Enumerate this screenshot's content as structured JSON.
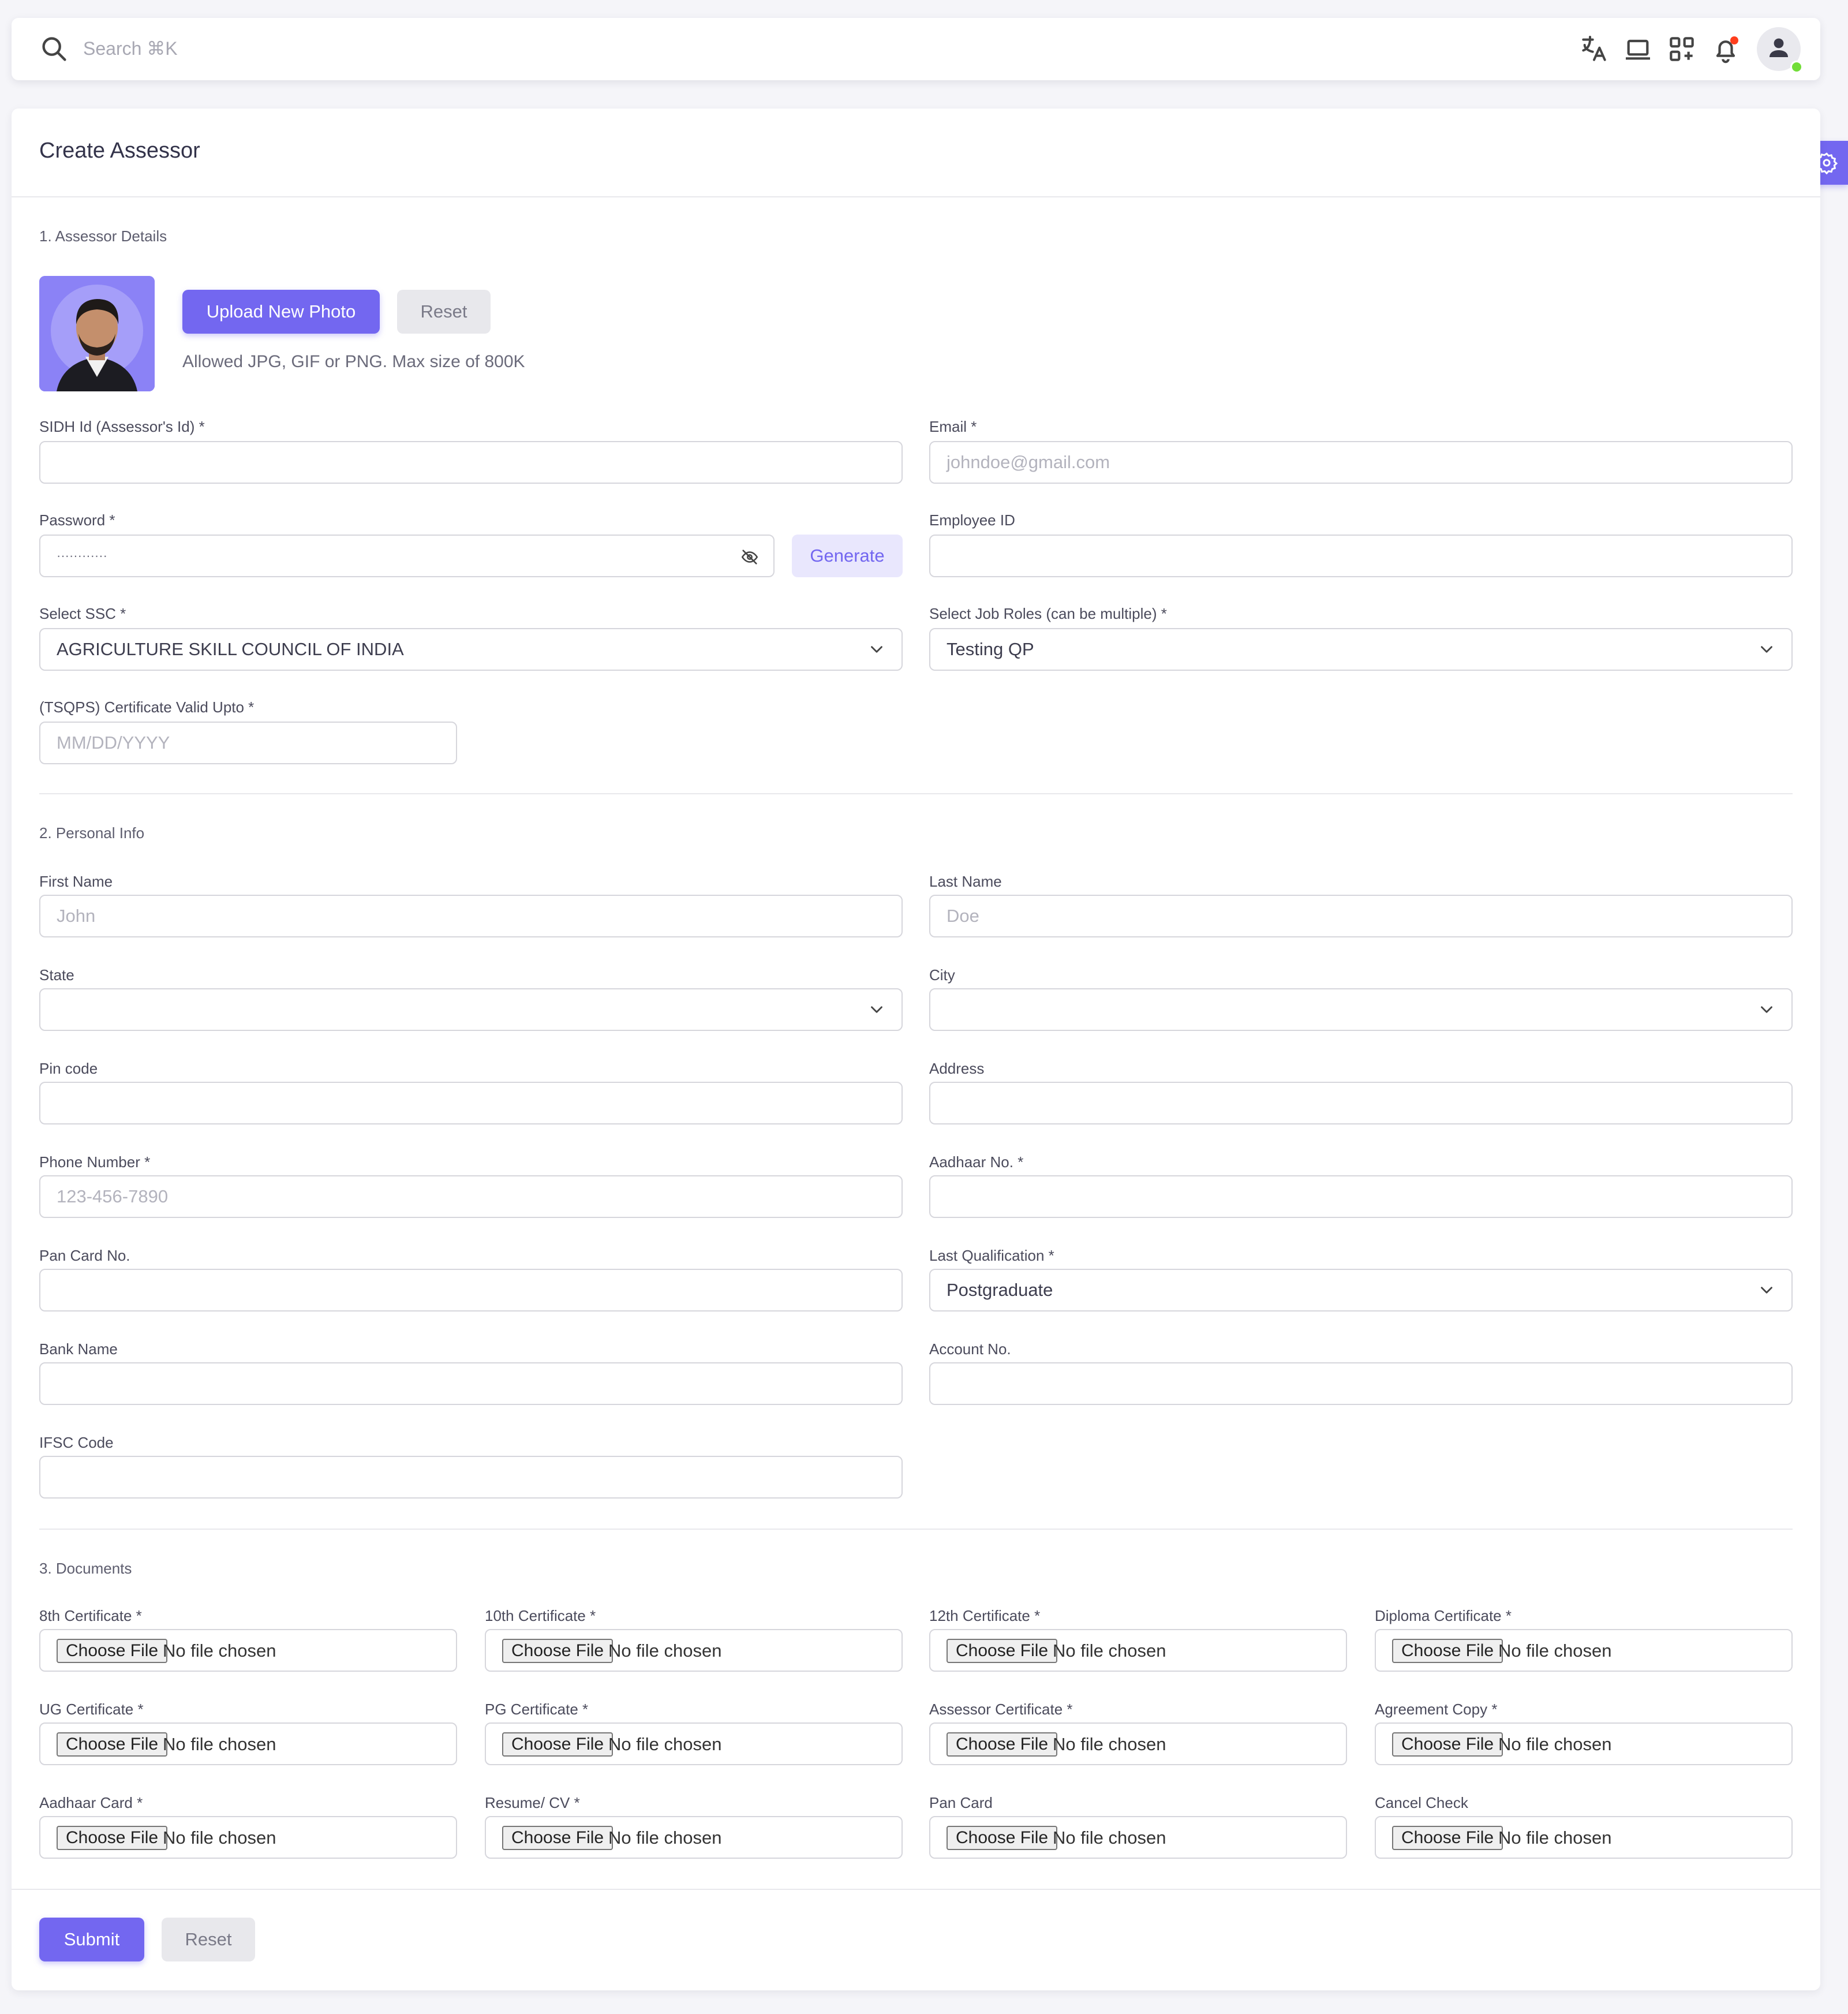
{
  "navbar": {
    "search_placeholder": "Search ⌘K",
    "icons": [
      "search-icon",
      "translate-icon",
      "laptop-icon",
      "grid-add-icon",
      "bell-icon",
      "user-icon"
    ]
  },
  "page": {
    "title": "Create Assessor"
  },
  "sections": {
    "assessor": "1. Assessor Details",
    "personal": "2. Personal Info",
    "documents": "3. Documents"
  },
  "photo": {
    "upload_label": "Upload New Photo",
    "reset_label": "Reset",
    "hint": "Allowed JPG, GIF or PNG. Max size of 800K"
  },
  "assessor": {
    "sidh_label": "SIDH Id (Assessor's Id) *",
    "sidh_value": "",
    "email_label": "Email *",
    "email_placeholder": "johndoe@gmail.com",
    "password_label": "Password *",
    "password_value": "············",
    "generate_label": "Generate",
    "employee_label": "Employee ID",
    "employee_value": "",
    "ssc_label": "Select SSC *",
    "ssc_value": "AGRICULTURE SKILL COUNCIL OF INDIA",
    "jobroles_label": "Select Job Roles (can be multiple) *",
    "jobroles_value": "Testing QP",
    "cert_label": "(TSQPS) Certificate Valid Upto *",
    "cert_placeholder": "MM/DD/YYYY"
  },
  "personal": {
    "first_label": "First Name",
    "first_placeholder": "John",
    "last_label": "Last Name",
    "last_placeholder": "Doe",
    "state_label": "State",
    "state_value": "",
    "city_label": "City",
    "city_value": "",
    "pin_label": "Pin code",
    "address_label": "Address",
    "phone_label": "Phone Number *",
    "phone_placeholder": "123-456-7890",
    "aadhaar_label": "Aadhaar No. *",
    "pan_label": "Pan Card No.",
    "qualification_label": "Last Qualification *",
    "qualification_value": "Postgraduate",
    "bank_label": "Bank Name",
    "account_label": "Account No.",
    "ifsc_label": "IFSC Code"
  },
  "documents": {
    "choose_label": "Choose File",
    "no_file_label": "No file chosen",
    "items": [
      "8th Certificate *",
      "10th Certificate *",
      "12th Certificate *",
      "Diploma Certificate *",
      "UG Certificate *",
      "PG Certificate *",
      "Assessor Certificate *",
      "Agreement Copy *",
      "Aadhaar Card *",
      "Resume/ CV *",
      "Pan Card",
      "Cancel Check"
    ]
  },
  "footer": {
    "submit_label": "Submit",
    "reset_label": "Reset"
  },
  "colors": {
    "primary": "#7367f0",
    "notification": "#ff3e1d",
    "online": "#71dd37"
  }
}
